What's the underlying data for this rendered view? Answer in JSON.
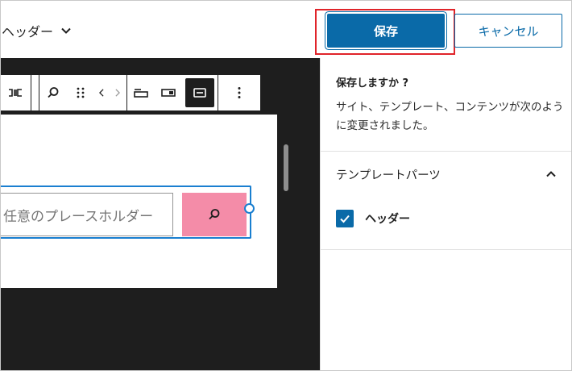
{
  "header": {
    "template_title": "ヘッダー",
    "save_label": "保存",
    "cancel_label": "キャンセル"
  },
  "editor": {
    "search_placeholder": "任意のプレースホルダー",
    "search_button_color": "#f48ca8"
  },
  "sidebar": {
    "title": "保存しますか ?",
    "description": "サイト、テンプレート、コンテンツが次のように変更されました。",
    "panel_title": "テンプレートパーツ",
    "items": [
      {
        "label": "ヘッダー",
        "checked": true
      }
    ]
  },
  "colors": {
    "accent": "#0a6aa8",
    "highlight": "#e0242a",
    "selection": "#1a7fd0",
    "canvas_bg": "#1e1e1e"
  }
}
